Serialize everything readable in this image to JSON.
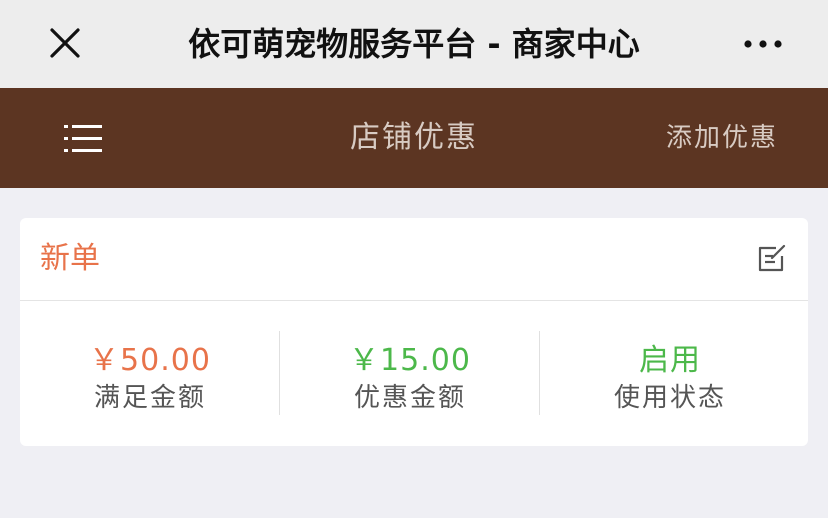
{
  "colors": {
    "topbar_bg": "#ededed",
    "navbar_bg": "#5c3522",
    "accent_orange": "#e8734a",
    "accent_green": "#4cb84a"
  },
  "window": {
    "title": "依可萌宠物服务平台 - 商家中心",
    "close_icon": "close-icon",
    "more_icon": "more-dots-icon"
  },
  "navbar": {
    "menu_icon": "menu-list-icon",
    "title": "店铺优惠",
    "add_label": "添加优惠"
  },
  "coupon": {
    "name": "新单",
    "edit_icon": "edit-icon",
    "min_amount_value": "￥50.00",
    "min_amount_label": "满足金额",
    "discount_value": "￥15.00",
    "discount_label": "优惠金额",
    "status_value": "启用",
    "status_label": "使用状态"
  }
}
